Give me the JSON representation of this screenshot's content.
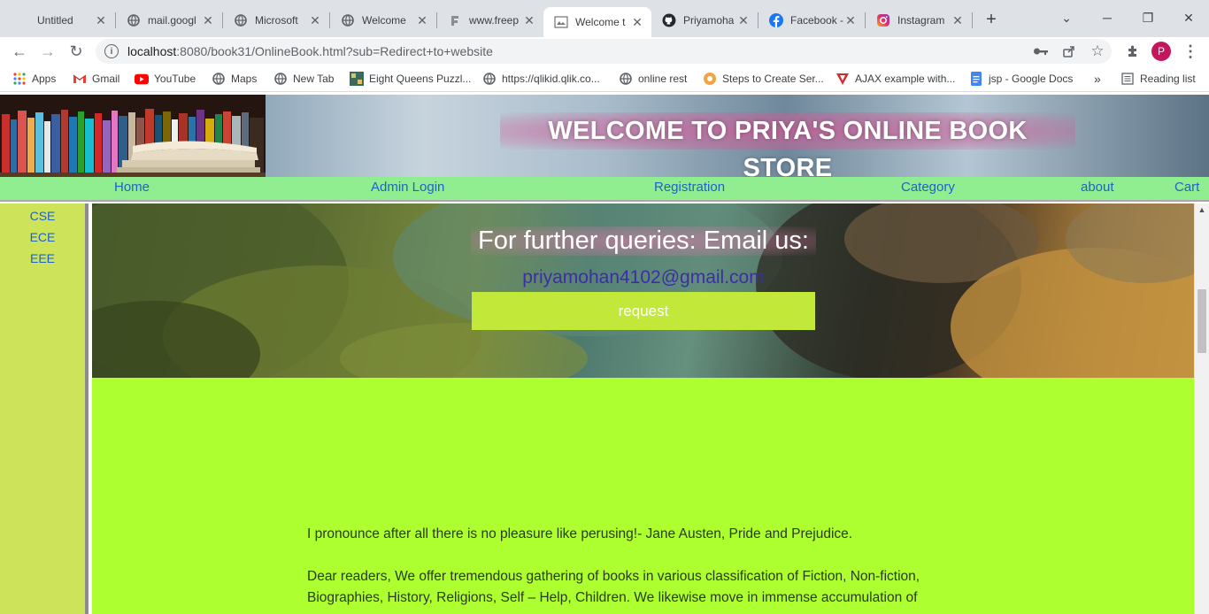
{
  "browser": {
    "tabs": [
      {
        "title": "Untitled",
        "icon": "blank-icon"
      },
      {
        "title": "mail.googl",
        "icon": "globe-icon"
      },
      {
        "title": "Microsoft",
        "icon": "globe-icon"
      },
      {
        "title": "Welcome",
        "icon": "globe-icon"
      },
      {
        "title": "www.freep",
        "icon": "freepik-icon"
      },
      {
        "title": "Welcome t",
        "icon": "page-icon",
        "active": true
      },
      {
        "title": "Priyamoha",
        "icon": "github-icon"
      },
      {
        "title": "Facebook -",
        "icon": "facebook-icon"
      },
      {
        "title": "Instagram",
        "icon": "instagram-icon"
      }
    ],
    "new_tab_label": "+",
    "url_host": "localhost",
    "url_rest": ":8080/book31/OnlineBook.html?sub=Redirect+to+website",
    "profile_initial": "P",
    "bookmarks": [
      {
        "label": "Apps",
        "icon": "apps-icon"
      },
      {
        "label": "Gmail",
        "icon": "gmail-icon"
      },
      {
        "label": "YouTube",
        "icon": "youtube-icon"
      },
      {
        "label": "Maps",
        "icon": "globe-icon"
      },
      {
        "label": "New Tab",
        "icon": "globe-icon"
      },
      {
        "label": "Eight Queens Puzzl...",
        "icon": "puzzle-icon"
      },
      {
        "label": "https://qlikid.qlik.co...",
        "icon": "globe-icon"
      },
      {
        "label": "online rest",
        "icon": "globe-icon"
      },
      {
        "label": "Steps to Create Ser...",
        "icon": "steps-icon"
      },
      {
        "label": "AJAX example with...",
        "icon": "ajax-icon"
      },
      {
        "label": "jsp - Google Docs",
        "icon": "docs-icon"
      }
    ],
    "bookmarks_more": "»",
    "reading_list": "Reading list"
  },
  "site": {
    "title": "WELCOME TO PRIYA'S ONLINE BOOK STORE",
    "nav": [
      "Home",
      "Admin Login",
      "Registration",
      "Category",
      "about",
      "Cart"
    ],
    "sidebar": [
      "CSE",
      "ECE",
      "EEE"
    ],
    "hero": {
      "heading": "For further queries: Email us:",
      "email": "priyamohan4102@gmail.com",
      "button": "request"
    },
    "paragraphs": [
      "I pronounce after all there is no pleasure like perusing!- Jane Austen, Pride and Prejudice.",
      "Dear readers, We offer tremendous gathering of books in various classification of Fiction, Non-fiction, Biographies, History, Religions, Self – Help, Children. We likewise move in immense accumulation of"
    ]
  },
  "colors": {
    "nav_bg": "#90ee90",
    "sidebar_bg": "#cde35a",
    "content_bg": "#adff2f",
    "button_bg": "#c2e83a",
    "link": "#1f62c8"
  }
}
